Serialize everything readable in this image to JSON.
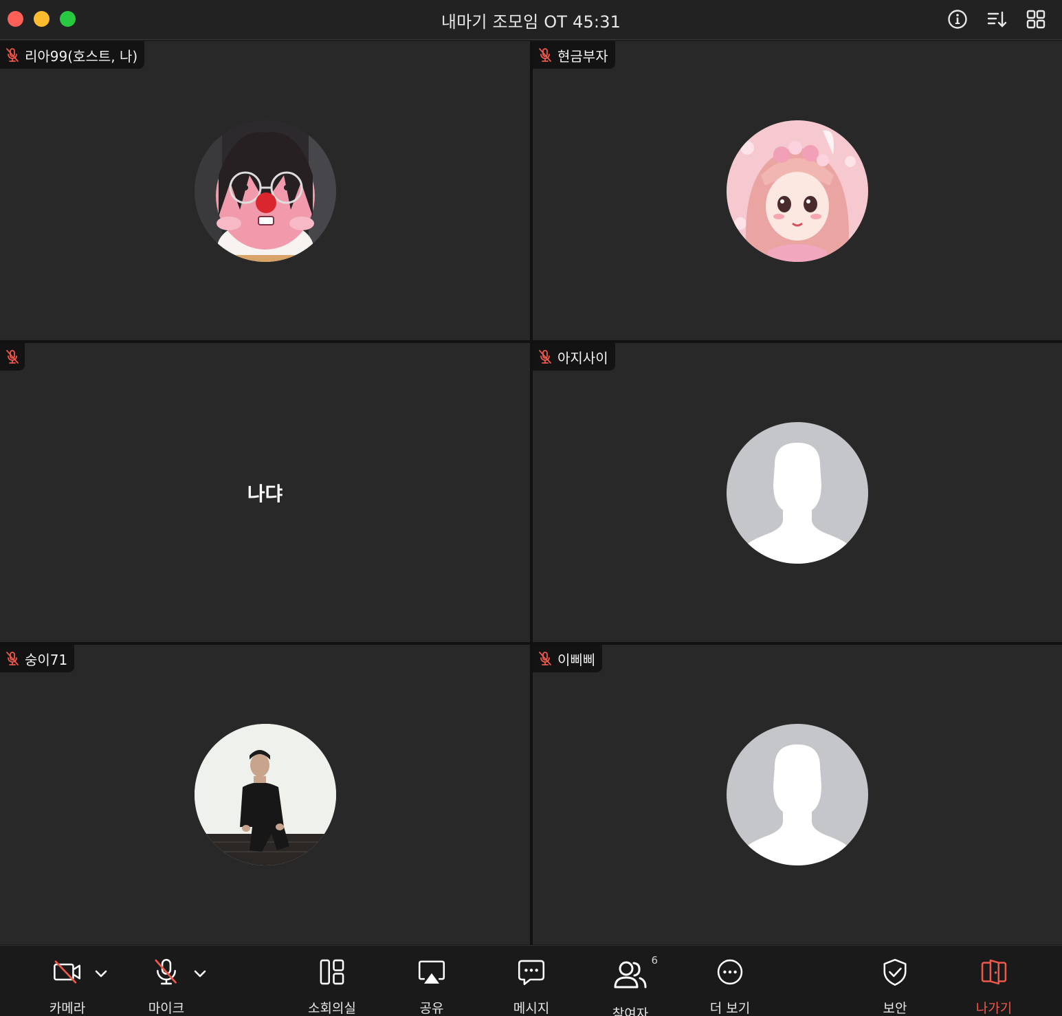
{
  "window": {
    "title": "내마기 조모임 OT 45:31"
  },
  "participants": [
    {
      "name": "리아99(호스트, 나)",
      "muted": true,
      "avatar": "pink-plush-photo"
    },
    {
      "name": "현금부자",
      "muted": true,
      "avatar": "anime-girl-illustration"
    },
    {
      "name": "",
      "muted": true,
      "display_text": "나댜"
    },
    {
      "name": "아지사이",
      "muted": true,
      "avatar": "default-person"
    },
    {
      "name": "숭이71",
      "muted": true,
      "avatar": "person-photo"
    },
    {
      "name": "이삐삐",
      "muted": true,
      "avatar": "default-person"
    }
  ],
  "toolbar": {
    "camera": "카메라",
    "mic": "마이크",
    "breakout": "소회의실",
    "share": "공유",
    "message": "메시지",
    "participants": "참여자",
    "participants_count": "6",
    "more": "더 보기",
    "security": "보안",
    "leave": "나가기"
  },
  "colors": {
    "muted_icon": "#f0584c",
    "leave": "#f0584c",
    "tile_bg": "#282828"
  }
}
